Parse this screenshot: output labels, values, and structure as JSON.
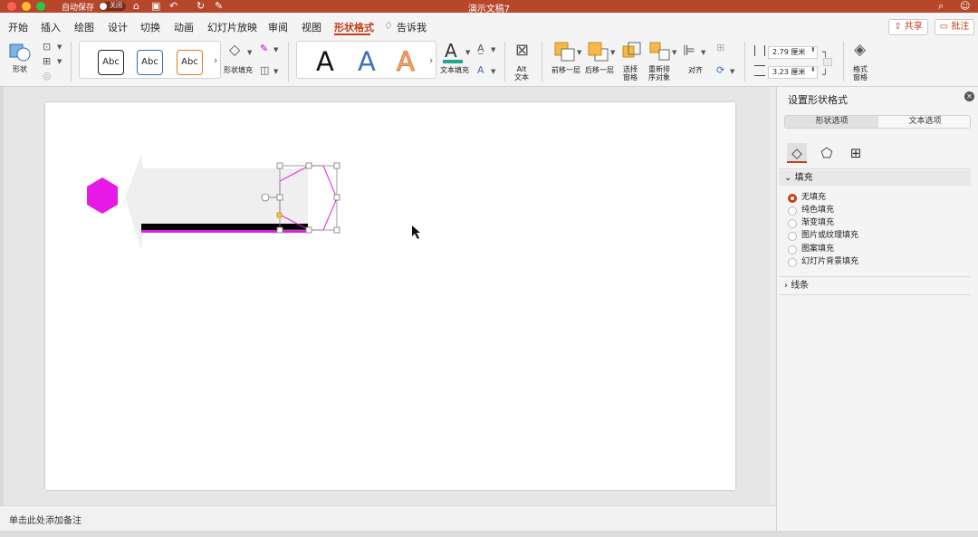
{
  "titlebar": {
    "autosave_label": "自动保存",
    "autosave_state": "关闭",
    "doc_title": "演示文稿7"
  },
  "tabs": [
    {
      "label": "开始"
    },
    {
      "label": "插入"
    },
    {
      "label": "绘图"
    },
    {
      "label": "设计"
    },
    {
      "label": "切换"
    },
    {
      "label": "动画"
    },
    {
      "label": "幻灯片放映"
    },
    {
      "label": "审阅"
    },
    {
      "label": "视图"
    },
    {
      "label": "形状格式"
    },
    {
      "label": "告诉我"
    }
  ],
  "active_tab": "形状格式",
  "header_buttons": {
    "share": "共享",
    "comments": "批注"
  },
  "ribbon": {
    "shapes_label": "形状",
    "style_samples": [
      "Abc",
      "Abc",
      "Abc"
    ],
    "shape_fill_label": "形状填充",
    "wordart_letter": "A",
    "text_fill_label": "文本填充",
    "alt_text_label": "Alt\n文本",
    "bring_forward_label": "前移一层",
    "send_backward_label": "后移一层",
    "selection_pane_label": "选择\n窗格",
    "reorder_label": "重新排\n序对象",
    "align_label": "对齐",
    "height_value": "2.79 厘米",
    "width_value": "3.23 厘米",
    "format_pane_label": "格式\n窗格"
  },
  "notes_placeholder": "单击此处添加备注",
  "panel": {
    "title": "设置形状格式",
    "tab_shape": "形状选项",
    "tab_text": "文本选项",
    "fill_section": "填充",
    "fill_options": [
      "无填充",
      "纯色填充",
      "渐变填充",
      "图片或纹理填充",
      "图案填充",
      "幻灯片背景填充"
    ],
    "selected_fill": "无填充",
    "line_section": "线条"
  },
  "colors": {
    "accent": "#c43e1c",
    "titlebar": "#b7472a",
    "hexagon": "#e619e6",
    "banner_gray": "#f0f0f0",
    "magenta_line": "#e619e6"
  }
}
